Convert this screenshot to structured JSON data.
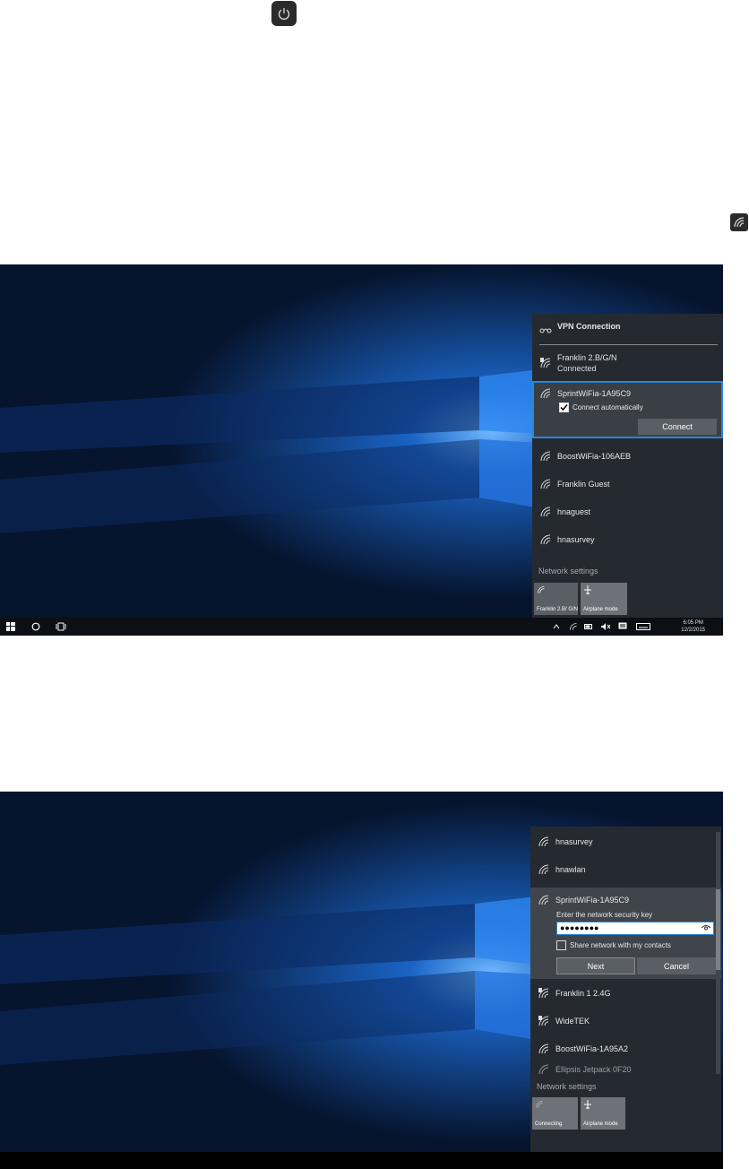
{
  "icons": {
    "top_power": "power-icon",
    "top_wifi": "wifi-icon"
  },
  "shot1": {
    "vpn": {
      "label": "VPN Connection"
    },
    "networks": [
      {
        "name": "Franklin 2.B/G/N",
        "status": "Connected",
        "icon": "wifi-secured-icon"
      },
      {
        "name": "SprintWiFia-1A95C9",
        "icon": "wifi-icon"
      },
      {
        "name": "BoostWiFia-106AEB",
        "icon": "wifi-icon"
      },
      {
        "name": "Franklin Guest",
        "icon": "wifi-icon"
      },
      {
        "name": "hnaguest",
        "icon": "wifi-icon"
      },
      {
        "name": "hnasurvey",
        "icon": "wifi-icon"
      }
    ],
    "connect_auto_label": "Connect automatically",
    "connect_button": "Connect",
    "network_settings": "Network settings",
    "tiles": [
      {
        "label": "Franklin 2.B/ G/N",
        "icon": "wifi-icon"
      },
      {
        "label": "Airplane mode",
        "icon": "airplane-icon"
      }
    ],
    "taskbar": {
      "time": "6:05 PM",
      "date": "12/2/2015"
    }
  },
  "shot2": {
    "networks_top": [
      {
        "name": "hnasurvey",
        "icon": "wifi-icon"
      },
      {
        "name": "hnawlan",
        "icon": "wifi-icon"
      }
    ],
    "selected": {
      "name": "SprintWiFia-1A95C9",
      "prompt": "Enter the network security key",
      "password": "●●●●●●●●",
      "share_label": "Share network with my contacts"
    },
    "next_button": "Next",
    "cancel_button": "Cancel",
    "networks_bottom": [
      {
        "name": "Franklin 1 2.4G",
        "icon": "wifi-secured-icon"
      },
      {
        "name": "WideTEK",
        "icon": "wifi-secured-icon"
      },
      {
        "name": "BoostWiFia-1A95A2",
        "icon": "wifi-icon"
      },
      {
        "name": "Ellipsis Jetpack 0F20",
        "icon": "wifi-icon"
      }
    ],
    "network_settings": "Network settings",
    "tiles": [
      {
        "label": "Connecting",
        "icon": "wifi-icon"
      },
      {
        "label": "Airplane mode",
        "icon": "airplane-icon"
      }
    ]
  },
  "colors": {
    "accent": "#2a86d8",
    "flyout_bg": "#252a31",
    "selected_bg": "#3a3f46"
  }
}
